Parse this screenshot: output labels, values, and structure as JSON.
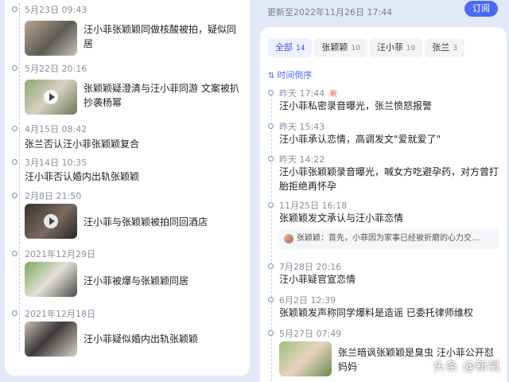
{
  "left_timeline": [
    {
      "time": "5月23日 09:43",
      "text": "汪小菲张颖颖同做核酸被拍，疑似同居",
      "has_image": true,
      "is_video": false
    },
    {
      "time": "5月22日 20:16",
      "text": "张颖颖疑澄清与汪小菲同游 文案被扒抄袭杨幂",
      "has_image": true,
      "is_video": true
    },
    {
      "time": "4月15日 08:42",
      "text": "张兰否认汪小菲张颖颖复合",
      "has_image": false
    },
    {
      "time": "3月14日 10:35",
      "text": "汪小菲否认婚内出轨张颖颖",
      "has_image": false
    },
    {
      "time": "2月8日 21:50",
      "text": "汪小菲与张颖颖被拍同回酒店",
      "has_image": true,
      "is_video": true
    },
    {
      "time": "2021年12月29日",
      "text": "汪小菲被爆与张颖颖同居",
      "has_image": true,
      "is_video": false
    },
    {
      "time": "2021年12月18日",
      "text": "汪小菲疑似婚内出轨张颖颖",
      "has_image": true,
      "is_video": false
    }
  ],
  "header": {
    "updated_text": "更新至2022年11月26日 17:44",
    "subscribe_label": "订阅"
  },
  "tabs": [
    {
      "label": "全部",
      "count": "14",
      "active": true
    },
    {
      "label": "张颖颖",
      "count": "10",
      "active": false
    },
    {
      "label": "汪小菲",
      "count": "10",
      "active": false
    },
    {
      "label": "张兰",
      "count": "3",
      "active": false
    }
  ],
  "sort_label": "时间倒序",
  "right_timeline": [
    {
      "time": "昨天 17:44",
      "badge": "新",
      "text": "汪小菲私密录音曝光，张兰愤怒报警"
    },
    {
      "time": "昨天 15:43",
      "text": "汪小菲承认恋情，高调发文\"爱就爱了\""
    },
    {
      "time": "昨天 14:22",
      "text": "汪小菲张颖颖录音曝光，喊女方吃避孕药，对方曾打胎拒绝再怀孕"
    },
    {
      "time": "11月25日 16:18",
      "text": "张颖颖发文承认与汪小菲恋情",
      "quote": "张颖颖：首先，小菲因为家事已经被折磨的心力交…"
    },
    {
      "time": "7月28日 20:16",
      "text": "汪小菲疑官宣恋情"
    },
    {
      "time": "6月2日 12:39",
      "text": "张颖颖发声称同学爆料是造谣 已委托律师维权"
    },
    {
      "time": "5月27日 07:49",
      "text": "张兰暗讽张颖颖是臭虫 汪小菲公开怼妈妈",
      "has_image": true
    }
  ],
  "watermark": "头条 @新氧",
  "colors": {
    "accent": "#4a6cf0",
    "background": "#e3e8f7",
    "badge": "#e8573c"
  }
}
